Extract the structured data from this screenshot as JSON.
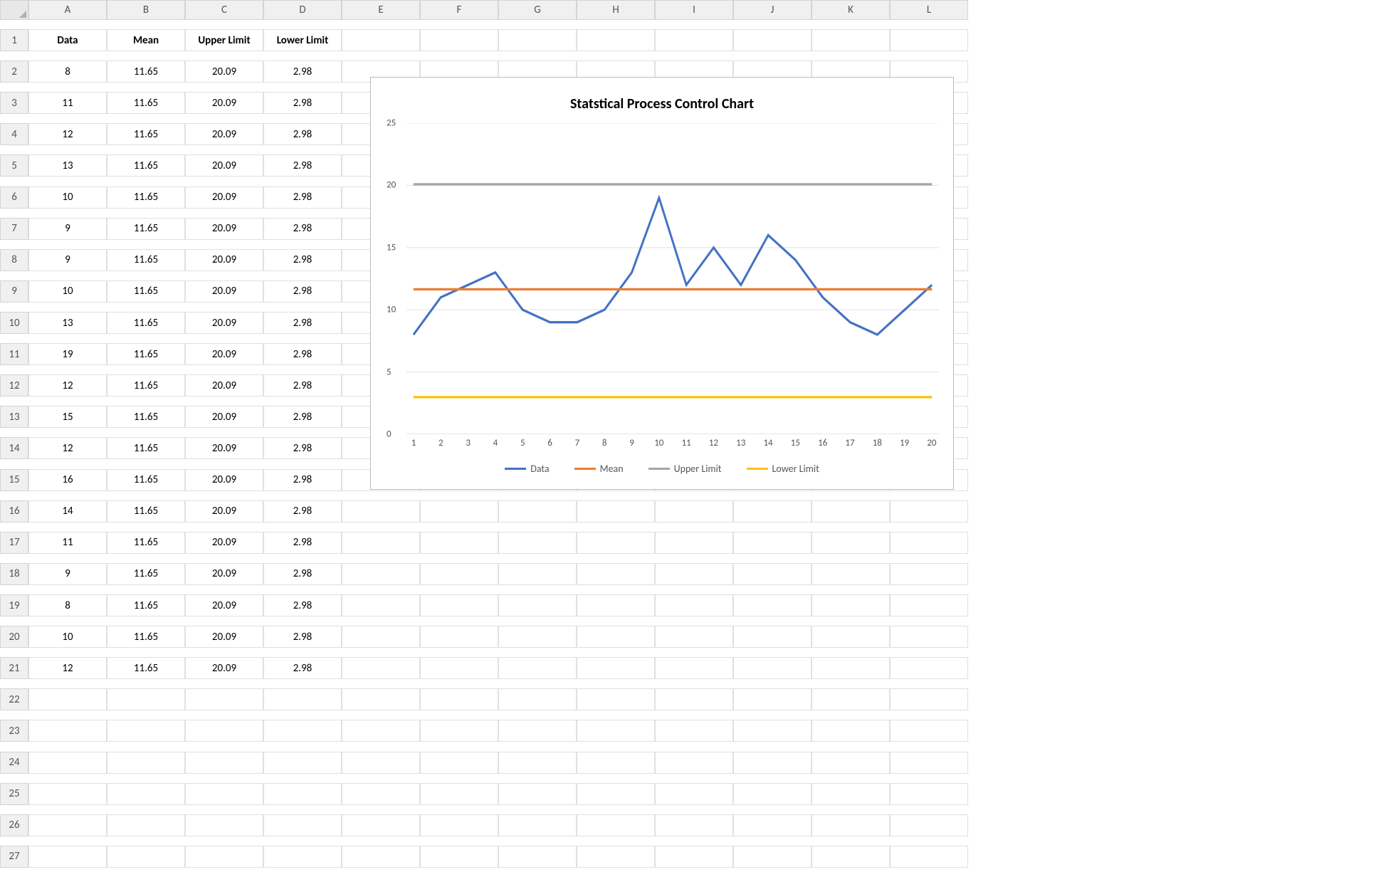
{
  "columns": [
    "A",
    "B",
    "C",
    "D",
    "E",
    "F",
    "G",
    "H",
    "I",
    "J",
    "K",
    "L"
  ],
  "rowCount": 27,
  "headers": [
    "Data",
    "Mean",
    "Upper Limit",
    "Lower Limit"
  ],
  "rows": [
    [
      8,
      11.65,
      20.09,
      2.98
    ],
    [
      11,
      11.65,
      20.09,
      2.98
    ],
    [
      12,
      11.65,
      20.09,
      2.98
    ],
    [
      13,
      11.65,
      20.09,
      2.98
    ],
    [
      10,
      11.65,
      20.09,
      2.98
    ],
    [
      9,
      11.65,
      20.09,
      2.98
    ],
    [
      9,
      11.65,
      20.09,
      2.98
    ],
    [
      10,
      11.65,
      20.09,
      2.98
    ],
    [
      13,
      11.65,
      20.09,
      2.98
    ],
    [
      19,
      11.65,
      20.09,
      2.98
    ],
    [
      12,
      11.65,
      20.09,
      2.98
    ],
    [
      15,
      11.65,
      20.09,
      2.98
    ],
    [
      12,
      11.65,
      20.09,
      2.98
    ],
    [
      16,
      11.65,
      20.09,
      2.98
    ],
    [
      14,
      11.65,
      20.09,
      2.98
    ],
    [
      11,
      11.65,
      20.09,
      2.98
    ],
    [
      9,
      11.65,
      20.09,
      2.98
    ],
    [
      8,
      11.65,
      20.09,
      2.98
    ],
    [
      10,
      11.65,
      20.09,
      2.98
    ],
    [
      12,
      11.65,
      20.09,
      2.98
    ]
  ],
  "chart_data": {
    "type": "line",
    "title": "Statstical Process Control Chart",
    "x": [
      1,
      2,
      3,
      4,
      5,
      6,
      7,
      8,
      9,
      10,
      11,
      12,
      13,
      14,
      15,
      16,
      17,
      18,
      19,
      20
    ],
    "ylim": [
      0,
      25
    ],
    "yticks": [
      0,
      5,
      10,
      15,
      20,
      25
    ],
    "series": [
      {
        "name": "Data",
        "color": "#4472C4",
        "values": [
          8,
          11,
          12,
          13,
          10,
          9,
          9,
          10,
          13,
          19,
          12,
          15,
          12,
          16,
          14,
          11,
          9,
          8,
          10,
          12
        ]
      },
      {
        "name": "Mean",
        "color": "#ED7D31",
        "values": [
          11.65,
          11.65,
          11.65,
          11.65,
          11.65,
          11.65,
          11.65,
          11.65,
          11.65,
          11.65,
          11.65,
          11.65,
          11.65,
          11.65,
          11.65,
          11.65,
          11.65,
          11.65,
          11.65,
          11.65
        ]
      },
      {
        "name": "Upper Limit",
        "color": "#A5A5A5",
        "values": [
          20.09,
          20.09,
          20.09,
          20.09,
          20.09,
          20.09,
          20.09,
          20.09,
          20.09,
          20.09,
          20.09,
          20.09,
          20.09,
          20.09,
          20.09,
          20.09,
          20.09,
          20.09,
          20.09,
          20.09
        ]
      },
      {
        "name": "Lower Limit",
        "color": "#FFC000",
        "values": [
          2.98,
          2.98,
          2.98,
          2.98,
          2.98,
          2.98,
          2.98,
          2.98,
          2.98,
          2.98,
          2.98,
          2.98,
          2.98,
          2.98,
          2.98,
          2.98,
          2.98,
          2.98,
          2.98,
          2.98
        ]
      }
    ]
  }
}
